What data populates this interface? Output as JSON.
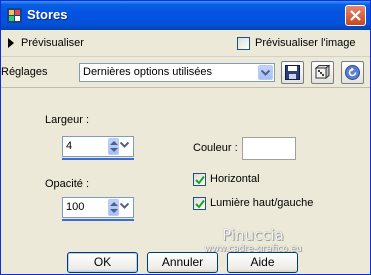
{
  "window": {
    "title": "Stores",
    "accent": "#0454e3",
    "close_color": "#c8461f"
  },
  "preview": {
    "label": "Prévisualiser",
    "preview_image_label": "Prévisualiser l'image",
    "preview_image_checked": false
  },
  "settings": {
    "label": "Réglages",
    "preset_value": "Dernières options utilisées",
    "icons": [
      "save-icon",
      "dice-icon",
      "reset-icon"
    ]
  },
  "params": {
    "width_label": "Largeur :",
    "width_value": "4",
    "opacity_label": "Opacité :",
    "opacity_value": "100",
    "color_label": "Couleur :",
    "color_value": "#ffffff",
    "horizontal_label": "Horizontal",
    "horizontal_checked": true,
    "light_label": "Lumière haut/gauche",
    "light_checked": true
  },
  "watermark": {
    "title": "Pinuccia",
    "url": "www.cadre-grafico.eu"
  },
  "buttons": {
    "ok": "OK",
    "cancel": "Annuler",
    "help": "Aide"
  }
}
